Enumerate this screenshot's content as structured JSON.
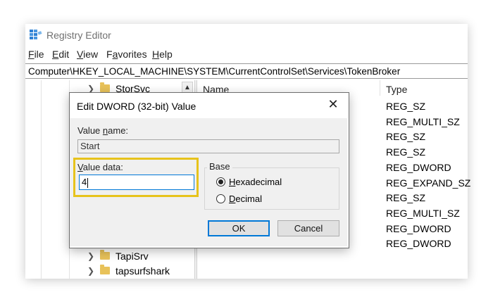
{
  "window": {
    "title": "Registry Editor",
    "icon": "registry-editor-icon",
    "accent": "#0078d7"
  },
  "menu": [
    {
      "prefix": "",
      "key": "F",
      "rest": "ile"
    },
    {
      "prefix": "",
      "key": "E",
      "rest": "dit"
    },
    {
      "prefix": "",
      "key": "V",
      "rest": "iew"
    },
    {
      "prefix": "F",
      "key": "a",
      "rest": "vorites"
    },
    {
      "prefix": "",
      "key": "H",
      "rest": "elp"
    }
  ],
  "address": "Computer\\HKEY_LOCAL_MACHINE\\SYSTEM\\CurrentControlSet\\Services\\TokenBroker",
  "tree": {
    "top_item": "StorSvc",
    "bottom_items": [
      "TapiSrv",
      "tapsurfshark"
    ],
    "folder_color": "#e8c25a"
  },
  "list": {
    "name_header": "Name",
    "type_header": "Type",
    "types": [
      "REG_SZ",
      "REG_MULTI_SZ",
      "REG_SZ",
      "REG_SZ",
      "REG_DWORD",
      "REG_EXPAND_SZ",
      "REG_SZ",
      "REG_MULTI_SZ",
      "REG_DWORD",
      "REG_DWORD"
    ]
  },
  "dialog": {
    "title": "Edit DWORD (32-bit) Value",
    "value_name_label": {
      "pre": "Value ",
      "key": "n",
      "post": "ame:"
    },
    "value_name": "Start",
    "value_data_label": {
      "pre": "",
      "key": "V",
      "post": "alue data:"
    },
    "value_data": "4",
    "base_label": "Base",
    "radios": [
      {
        "key": "H",
        "rest": "exadecimal",
        "checked": true
      },
      {
        "key": "D",
        "rest": "ecimal",
        "checked": false
      }
    ],
    "ok_label": "OK",
    "cancel_label": "Cancel",
    "highlight_color": "#e7c31c"
  }
}
